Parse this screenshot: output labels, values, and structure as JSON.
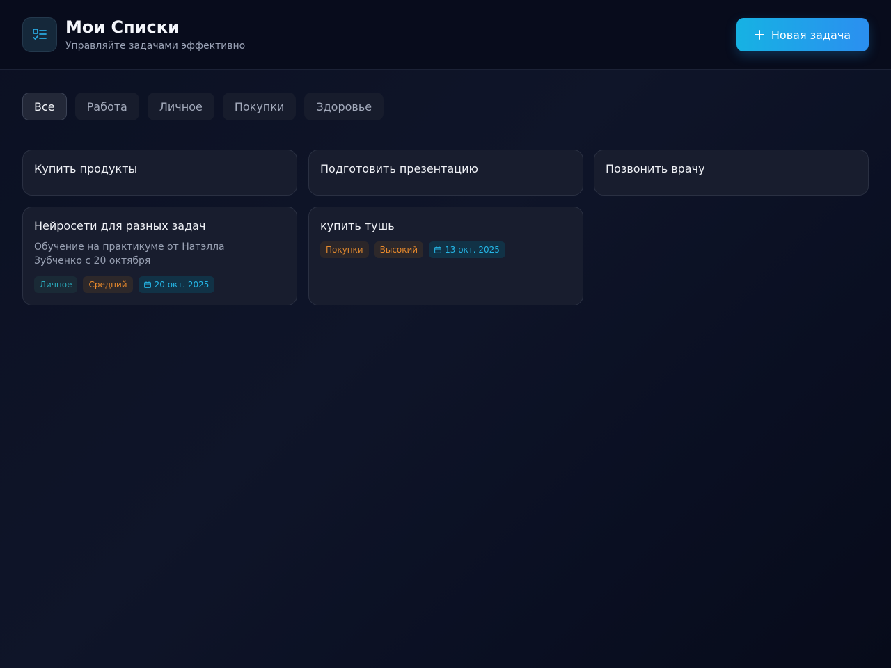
{
  "header": {
    "title": "Мои Списки",
    "subtitle": "Управляйте задачами эффективно",
    "logo_icon": "checklist-icon",
    "new_task_label": "Новая задача",
    "new_task_icon": "plus-icon"
  },
  "filters": [
    {
      "label": "Все",
      "active": true
    },
    {
      "label": "Работа",
      "active": false
    },
    {
      "label": "Личное",
      "active": false
    },
    {
      "label": "Покупки",
      "active": false
    },
    {
      "label": "Здоровье",
      "active": false
    }
  ],
  "tasks": [
    {
      "title": "Купить продукты"
    },
    {
      "title": "Подготовить презентацию"
    },
    {
      "title": "Позвонить врачу"
    },
    {
      "title": "Нейросети для разных задач",
      "description": "Обучение на практикуме от Натэлла Зубченко с 20 октября",
      "category": "Личное",
      "priority": "Средний",
      "date": "20 окт. 2025"
    },
    {
      "title": "купить тушь",
      "category": "Покупки",
      "priority": "Высокий",
      "date": "13 окт. 2025"
    }
  ],
  "colors": {
    "accent": "#1fa9e6",
    "background": "#0c1124",
    "card": "#181d2e",
    "priority_medium": "#e98a2c",
    "date": "#25b6e6"
  }
}
